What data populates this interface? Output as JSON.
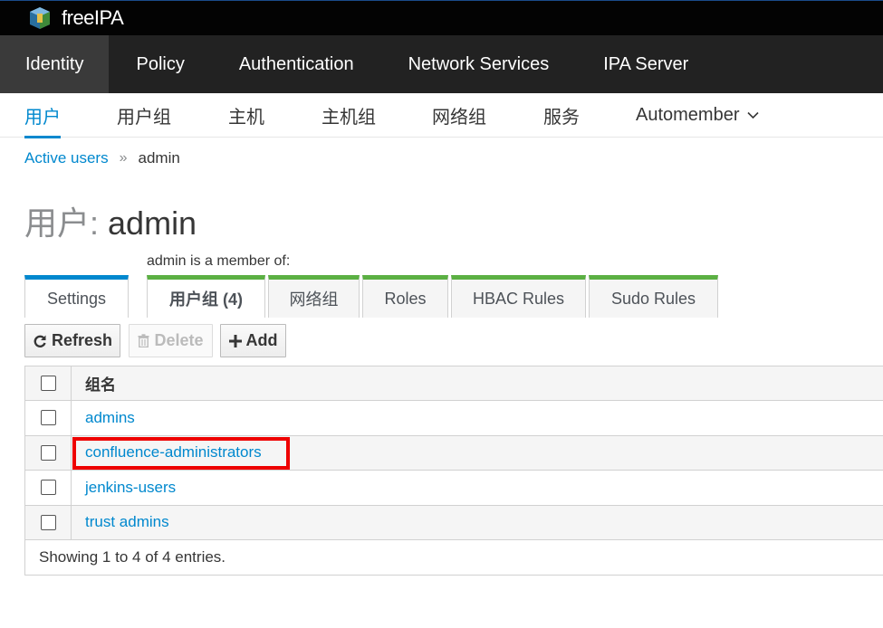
{
  "brand": {
    "name": "freeIPA"
  },
  "main_nav": [
    {
      "label": "Identity"
    },
    {
      "label": "Policy"
    },
    {
      "label": "Authentication"
    },
    {
      "label": "Network Services"
    },
    {
      "label": "IPA Server"
    }
  ],
  "sub_nav": [
    {
      "label": "用户"
    },
    {
      "label": "用户组"
    },
    {
      "label": "主机"
    },
    {
      "label": "主机组"
    },
    {
      "label": "网络组"
    },
    {
      "label": "服务"
    },
    {
      "label": "Automember"
    }
  ],
  "breadcrumb": {
    "link": "Active users",
    "separator": "»",
    "current": "admin"
  },
  "title": {
    "prefix": "用户:",
    "name": "admin"
  },
  "member_of_label": "admin is a member of:",
  "tabs": [
    {
      "label": "Settings"
    },
    {
      "label": "用户组 (4)"
    },
    {
      "label": "网络组"
    },
    {
      "label": "Roles"
    },
    {
      "label": "HBAC Rules"
    },
    {
      "label": "Sudo Rules"
    }
  ],
  "buttons": {
    "refresh": "Refresh",
    "delete": "Delete",
    "add": "Add"
  },
  "table": {
    "header": "组名",
    "rows": [
      "admins",
      "confluence-administrators",
      "jenkins-users",
      "trust admins"
    ],
    "footer": "Showing 1 to 4 of 4 entries."
  },
  "colors": {
    "accent": "#0088ce",
    "green": "#5bb043",
    "highlight": "#ee0000",
    "topbar": "#030303",
    "nav": "#222222"
  }
}
